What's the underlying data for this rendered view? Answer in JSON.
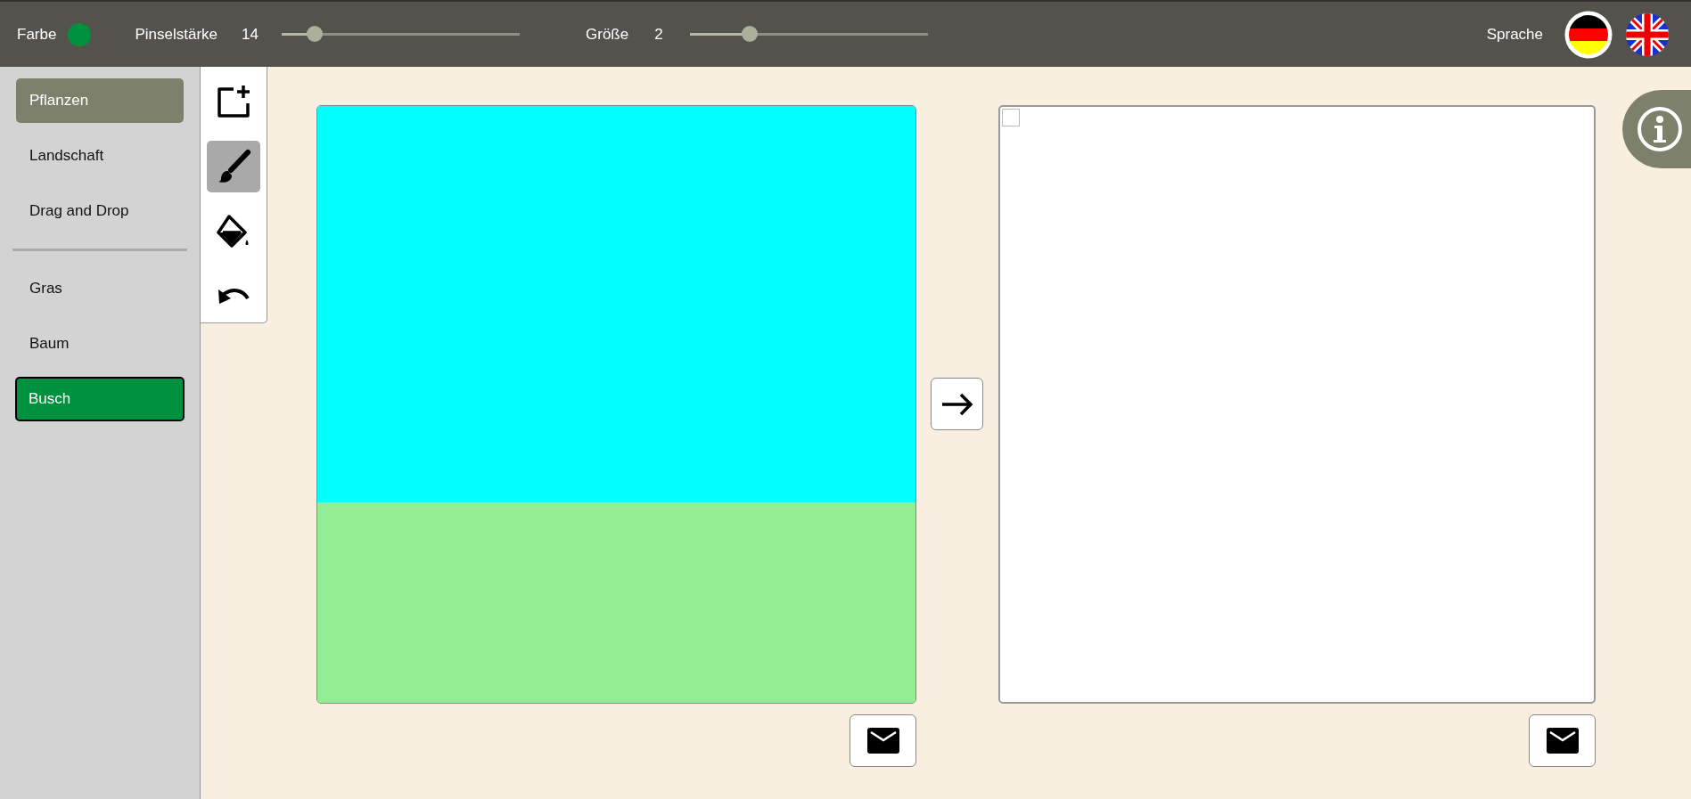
{
  "toolbar": {
    "color": {
      "label": "Farbe",
      "color": "#00913f"
    },
    "sliders": [
      {
        "label": "Pinselstärke",
        "reading": "14",
        "level": 0.14
      },
      {
        "label": "Größe",
        "reading": "2",
        "level": 0.25
      }
    ],
    "language": {
      "label": "Sprache",
      "flags": [
        {
          "kind": "german",
          "selected": true
        },
        {
          "kind": "british",
          "selected": false
        }
      ]
    }
  },
  "sidebar": {
    "categories": [
      {
        "label": "Pflanzen",
        "selected": true
      },
      {
        "label": "Landschaft",
        "selected": false
      },
      {
        "label": "Drag and Drop",
        "selected": false
      }
    ],
    "items": [
      {
        "label": "Gras",
        "selected": false
      },
      {
        "label": "Baum",
        "selected": false
      },
      {
        "label": "Busch",
        "selected": true
      }
    ]
  },
  "tools": [
    {
      "kind": "new",
      "selected": false
    },
    {
      "kind": "brush",
      "selected": true
    },
    {
      "kind": "fill",
      "selected": false
    },
    {
      "kind": "undo",
      "selected": false
    }
  ]
}
